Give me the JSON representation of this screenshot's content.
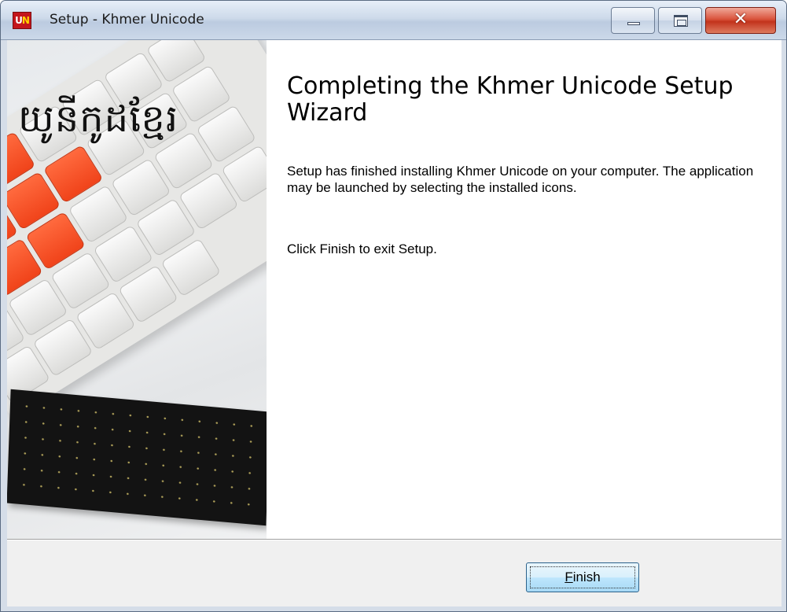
{
  "window": {
    "title": "Setup - Khmer Unicode",
    "app_icon": {
      "name": "khmer-unicode-logo-icon",
      "text_u": "U",
      "text_n": "N"
    },
    "controls": {
      "minimize": "minimize-icon",
      "maximize": "maximize-icon",
      "close": "close-icon"
    },
    "close_glyph": "✕"
  },
  "side_image": {
    "brand_text": "យូនីកូដខ្មែរ",
    "description": "khmer-keyboard-image"
  },
  "content": {
    "heading": "Completing the Khmer Unicode Setup Wizard",
    "paragraph1": "Setup has finished installing Khmer Unicode on your computer. The application may be launched by selecting the installed icons.",
    "paragraph2": "Click Finish to exit Setup."
  },
  "buttons": {
    "finish_accel": "F",
    "finish_rest": "inish"
  },
  "colors": {
    "accent_orange": "#f0431a",
    "titlebar": "#cddaea",
    "button_border": "#2c628b"
  }
}
